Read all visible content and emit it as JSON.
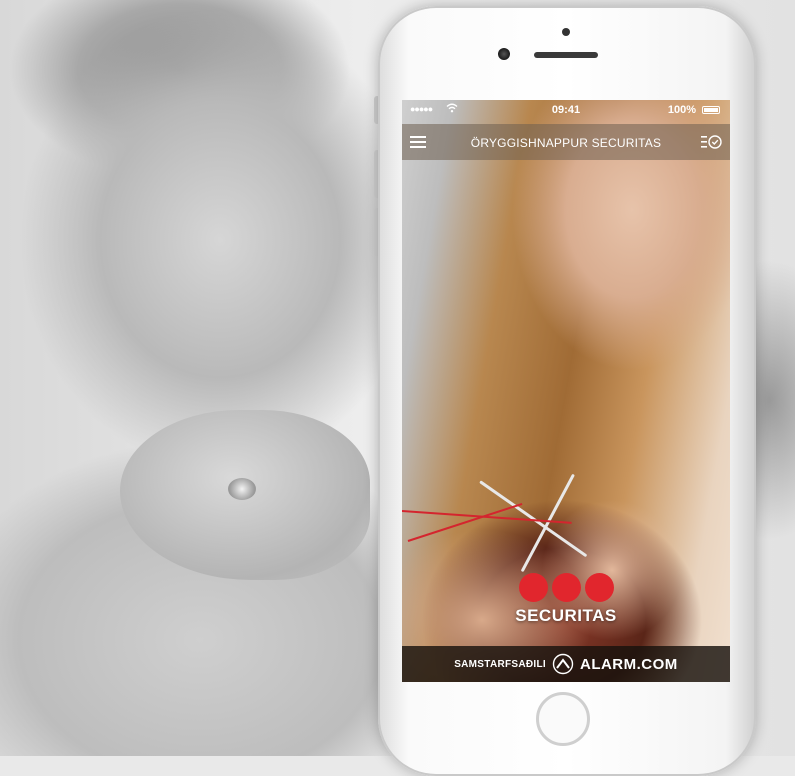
{
  "status_bar": {
    "signal": "●●●●●",
    "time": "09:41",
    "battery": "100%"
  },
  "nav_bar": {
    "title": "ÖRYGGISHNAPPUR SECURITAS"
  },
  "brand": {
    "name": "SECURITAS",
    "dot_color": "#e1262d"
  },
  "partner": {
    "label": "SAMSTARFSAÐILI",
    "brand": "ALARM.COM"
  },
  "icons": [
    "menu-icon",
    "checklist-icon",
    "wifi-icon",
    "battery-icon",
    "alarm-com-logo-icon"
  ]
}
